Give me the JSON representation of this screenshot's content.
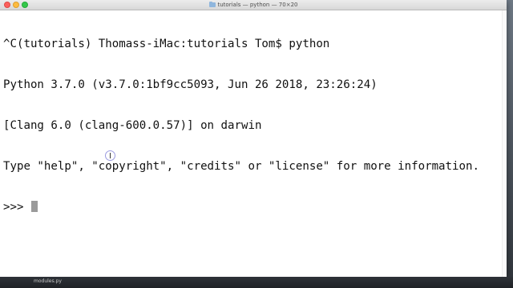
{
  "window": {
    "title": "tutorials — python — 70×20",
    "title_icon": "folder-icon"
  },
  "terminal": {
    "lines": [
      "^C(tutorials) Thomass-iMac:tutorials Tom$ python",
      "Python 3.7.0 (v3.7.0:1bf9cc5093, Jun 26 2018, 23:26:24)",
      "[Clang 6.0 (clang-600.0.57)] on darwin",
      "Type \"help\", \"copyright\", \"credits\" or \"license\" for more information."
    ],
    "prompt": ">>> "
  },
  "dock": {
    "label": "modules.py"
  },
  "colors": {
    "terminal_bg": "#ffffff",
    "terminal_fg": "#111111",
    "cursor": "#9a9a9a"
  }
}
